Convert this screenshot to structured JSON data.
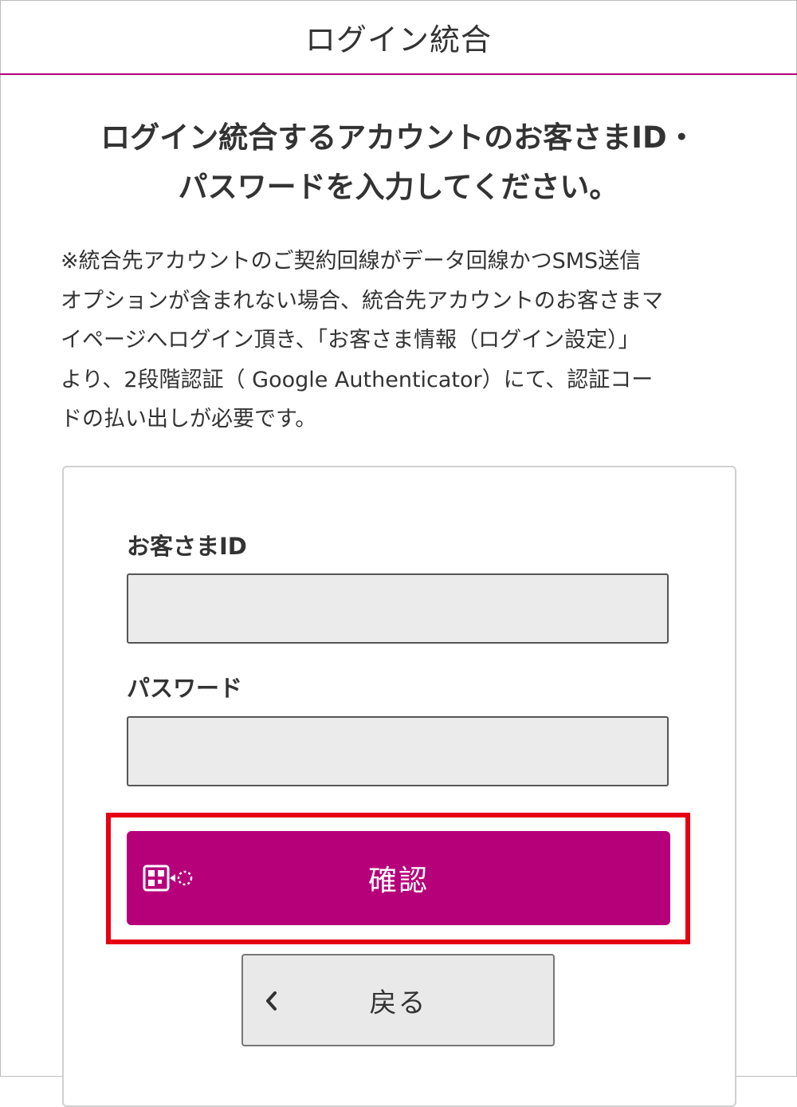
{
  "header": {
    "title": "ログイン統合"
  },
  "main": {
    "heading_lines": [
      "ログイン統合するアカウントのお客さまID・",
      "パスワードを入力してください。"
    ],
    "notice_lines": [
      "※統合先アカウントのご契約回線がデータ回線かつSMS送信",
      "オプションが含まれない場合、統合先アカウントのお客さまマ",
      "イページへログイン頂き、「お客さま情報（ログイン設定）」",
      "より、2段階認証（ Google Authenticator）にて、認証コー",
      "ドの払い出しが必要です。"
    ]
  },
  "form": {
    "customer_id": {
      "label": "お客さまID",
      "value": "",
      "placeholder": ""
    },
    "password": {
      "label": "パスワード",
      "value": "",
      "placeholder": ""
    },
    "confirm_label": "確認",
    "confirm_icon": "handwriting-qr-icon",
    "back_label": "戻る",
    "back_icon": "chevron-left-icon"
  },
  "colors": {
    "accent": "#b6007a",
    "highlight": "#e60012"
  }
}
